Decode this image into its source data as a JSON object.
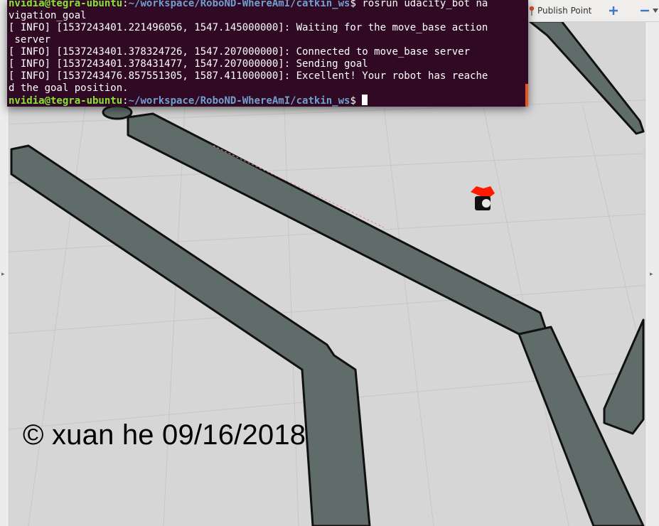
{
  "toolbar": {
    "publish_label": "Publish Point",
    "add_icon": "plus-icon",
    "remove_icon": "minus-icon",
    "dropdown_icon": "chevron-down-icon",
    "accent_color": "#3c78c8"
  },
  "terminal": {
    "prompt_user": "nvidia@tegra-ubuntu",
    "prompt_path": "~/workspace/RoboND-WhereAmI/catkin_ws",
    "prompt_symbol": "$",
    "command": "rosrun udacity_bot na",
    "command_wrap": "vigation_goal",
    "log_lines": [
      "[ INFO] [1537243401.221496056, 1547.145000000]: Waiting for the move_base action",
      " server",
      "[ INFO] [1537243401.378324726, 1547.207000000]: Connected to move_base server",
      "[ INFO] [1537243401.378431477, 1547.207000000]: Sending goal",
      "[ INFO] [1537243476.857551305, 1587.411000000]: Excellent! Your robot has reache",
      "d the goal position."
    ],
    "background_color": "#300a24",
    "user_color": "#8ae234",
    "path_color": "#729fcf"
  },
  "viewport": {
    "watermark": "© xuan he 09/16/2018",
    "map_wall_color": "#5f6c6a",
    "floor_color": "#d6d6d6",
    "robot_marker_color": "#ff1a00"
  }
}
